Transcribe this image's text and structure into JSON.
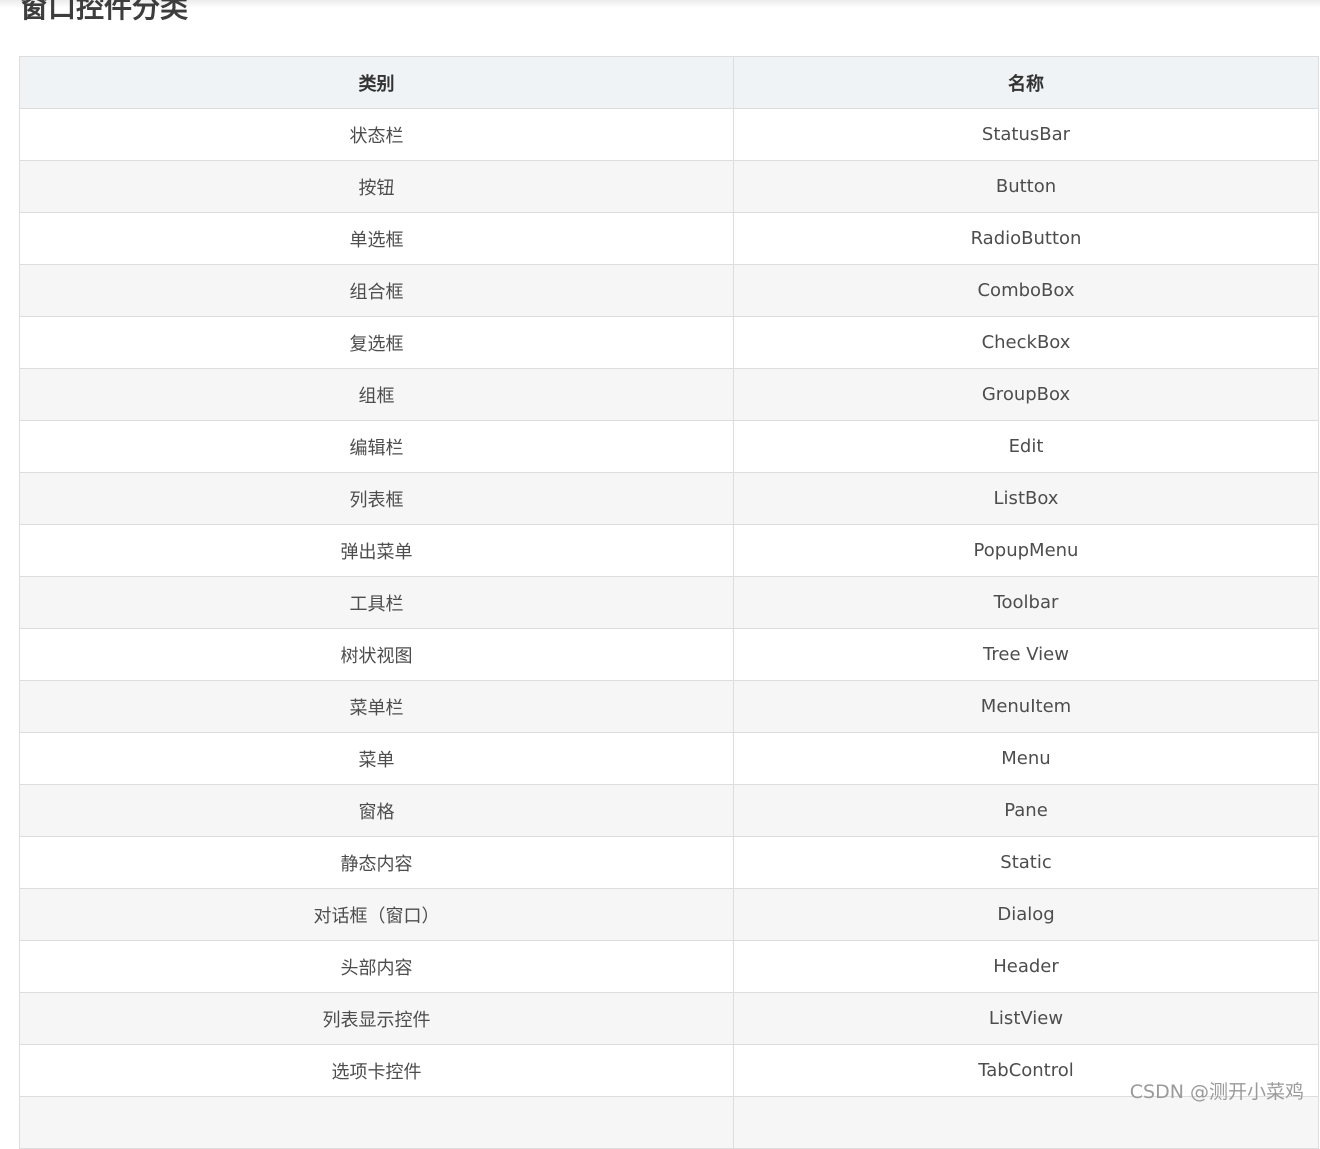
{
  "heading": "窗口控件分类",
  "table": {
    "headers": [
      "类别",
      "名称"
    ],
    "rows": [
      [
        "状态栏",
        "StatusBar"
      ],
      [
        "按钮",
        "Button"
      ],
      [
        "单选框",
        "RadioButton"
      ],
      [
        "组合框",
        "ComboBox"
      ],
      [
        "复选框",
        "CheckBox"
      ],
      [
        "组框",
        "GroupBox"
      ],
      [
        "编辑栏",
        "Edit"
      ],
      [
        "列表框",
        "ListBox"
      ],
      [
        "弹出菜单",
        "PopupMenu"
      ],
      [
        "工具栏",
        "Toolbar"
      ],
      [
        "树状视图",
        "Tree View"
      ],
      [
        "菜单栏",
        "MenuItem"
      ],
      [
        "菜单",
        "Menu"
      ],
      [
        "窗格",
        "Pane"
      ],
      [
        "静态内容",
        "Static"
      ],
      [
        "对话框（窗口）",
        "Dialog"
      ],
      [
        "头部内容",
        "Header"
      ],
      [
        "列表显示控件",
        "ListView"
      ],
      [
        "选项卡控件",
        "TabControl"
      ],
      [
        "",
        ""
      ]
    ]
  },
  "watermark": "CSDN @测开小菜鸡",
  "colors": {
    "header_bg": "#eff3f5",
    "stripe_bg": "#f6f6f6",
    "border": "#dddddd",
    "text": "#4d4d4d"
  }
}
